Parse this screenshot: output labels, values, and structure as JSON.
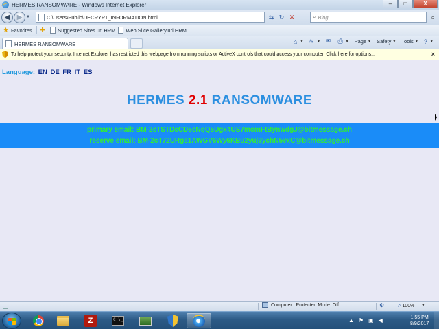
{
  "window": {
    "title": "HERMES RANSOMWARE - Windows Internet Explorer",
    "buttons": {
      "minimize": "–",
      "maximize": "□",
      "close": "X"
    }
  },
  "address": {
    "url": "C:\\Users\\Public\\DECRYPT_INFORMATION.html",
    "search_placeholder": "Bing"
  },
  "favorites": {
    "label": "Favorites",
    "items": [
      "Suggested Sites.url.HRM",
      "Web Slice Gallery.url.HRM"
    ]
  },
  "tab": {
    "label": "HERMES RANSOMWARE"
  },
  "commandbar": {
    "page": "Page",
    "safety": "Safety",
    "tools": "Tools"
  },
  "infobar": {
    "text": "To help protect your security, Internet Explorer has restricted this webpage from running scripts or ActiveX controls that could access your computer. Click here for options..."
  },
  "content": {
    "language_label": "Language:",
    "languages": [
      "EN",
      "DE",
      "FR",
      "IT",
      "ES"
    ],
    "headline_prefix": "HERMES ",
    "headline_version": "2.1",
    "headline_suffix": " RANSOMWARE",
    "primary_email": "primary email: BM-2cTSTDcCD5cNqQ5Ugx4US7momFtBynwdgJ@bitmessage.ch",
    "reserve_email": "reserve email: BM-2cT72URgs1AWGV6Wy6KBu2yuj3ychN5vxC@bitmessage.ch"
  },
  "statusbar": {
    "zone": "Computer | Protected Mode: Off",
    "zoom": "100%"
  },
  "taskbar": {
    "time": "1:55 PM",
    "date": "8/9/2017"
  },
  "colors": {
    "page_background": "#e8e8f5",
    "headline_blue": "#2b8fe0",
    "version_red": "#e00000",
    "email_band": "#1a8cf8",
    "email_text": "#33ee33"
  }
}
